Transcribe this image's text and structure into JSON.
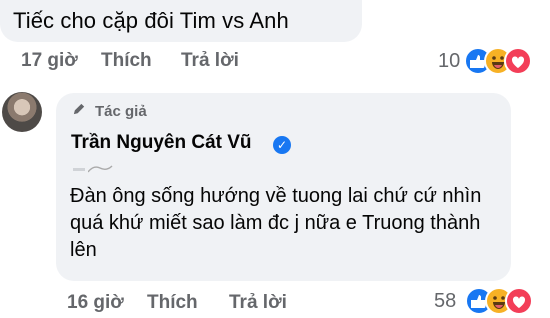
{
  "comment1": {
    "text": "Tiếc cho cặp đôi Tim vs Anh",
    "time": "17 giờ",
    "like": "Thích",
    "reply": "Trả lời",
    "reaction_count": "10"
  },
  "comment2": {
    "author_badge": "Tác giả",
    "author_name": "Trần Nguyên Cát Vũ",
    "text": "Đàn ông sống hướng về tuong lai chứ cứ nhìn quá khứ miết sao làm đc j nữa e Truong thành lên",
    "time": "16 giờ",
    "like": "Thích",
    "reply": "Trả lời",
    "reaction_count": "58"
  },
  "colors": {
    "bubble": "#f0f2f5",
    "meta_text": "#65676b",
    "like_blue": "#1877f2",
    "haha_yellow": "#f7b125",
    "love_red": "#f33e58"
  },
  "icons": [
    "pen-icon",
    "verified-badge-icon",
    "like-reaction-icon",
    "haha-reaction-icon",
    "love-reaction-icon"
  ]
}
